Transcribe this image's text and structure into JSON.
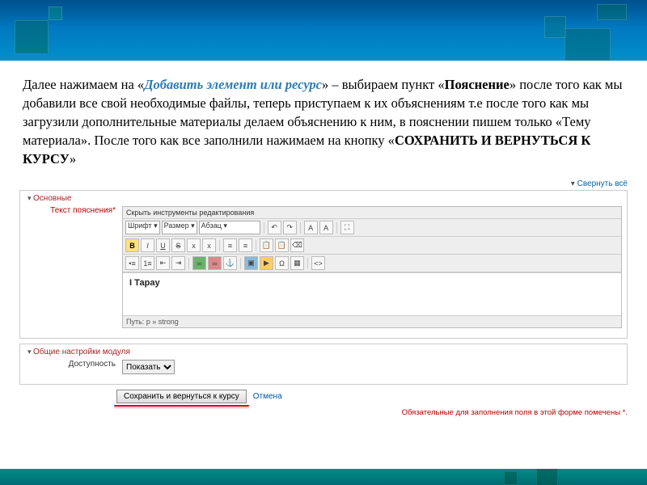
{
  "instruction": {
    "prefix": "Далее нажимаем на «",
    "link": "Добавить элемент или ресурс",
    "mid1": "» – выбираем пункт  «",
    "bold1": "Пояснение",
    "mid2": "» после того как мы добавили все свой необходимые файлы, теперь приступаем к их объяснениям т.е после того как мы загрузили дополнительные материалы делаем объяснению к ним, в пояснении пишем  только «Тему материала». После того как все  заполнили нажимаем на кнопку «",
    "bold2": "СОХРАНИТЬ И ВЕРНУТЬСЯ К КУРСУ",
    "suffix": "»"
  },
  "form": {
    "collapse_all": "Свернуть всё",
    "fs_main": "Основные",
    "label_text": "Текст пояснения*",
    "editor": {
      "hide_tools": "Скрыть инструменты редактирования",
      "font_label": "Шрифт",
      "size_label": "Размер",
      "para_label": "Абзац",
      "content": "І Тарау",
      "path": "Путь: p » strong"
    },
    "fs_module": "Общие настройки модуля",
    "label_avail": "Доступность",
    "avail_value": "Показать",
    "btn_save": "Сохранить и вернуться к курсу",
    "cancel": "Отмена",
    "req_note": "Обязательные для заполнения поля в этой форме помечены *."
  }
}
